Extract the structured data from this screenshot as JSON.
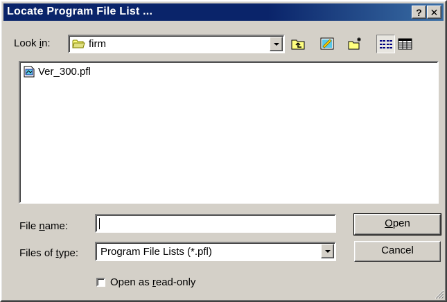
{
  "window": {
    "title": "Locate Program File List ...",
    "help_label": "?",
    "close_label": "✕"
  },
  "look_in": {
    "label_pre": "Look ",
    "label_key": "i",
    "label_post": "n:",
    "folder_icon": "folder-icon",
    "value": "firm"
  },
  "toolbar": {
    "buttons": [
      "up-one-level-icon",
      "desktop-icon",
      "new-folder-icon",
      "list-view-icon",
      "details-view-icon"
    ]
  },
  "files": [
    {
      "name": "Ver_300.pfl",
      "icon": "pfl-file-icon"
    }
  ],
  "file_name": {
    "label_pre": "File ",
    "label_key": "n",
    "label_post": "ame:",
    "value": ""
  },
  "file_type": {
    "label_pre": "Files of ",
    "label_key": "t",
    "label_post": "ype:",
    "value": "Program File Lists (*.pfl)"
  },
  "buttons": {
    "open_key": "O",
    "open_rest": "pen",
    "cancel": "Cancel"
  },
  "read_only": {
    "label_pre": "Open as ",
    "label_key": "r",
    "label_post": "ead-only",
    "checked": false
  },
  "colors": {
    "titlebar": "#0a246a",
    "face": "#d4d0c8"
  }
}
